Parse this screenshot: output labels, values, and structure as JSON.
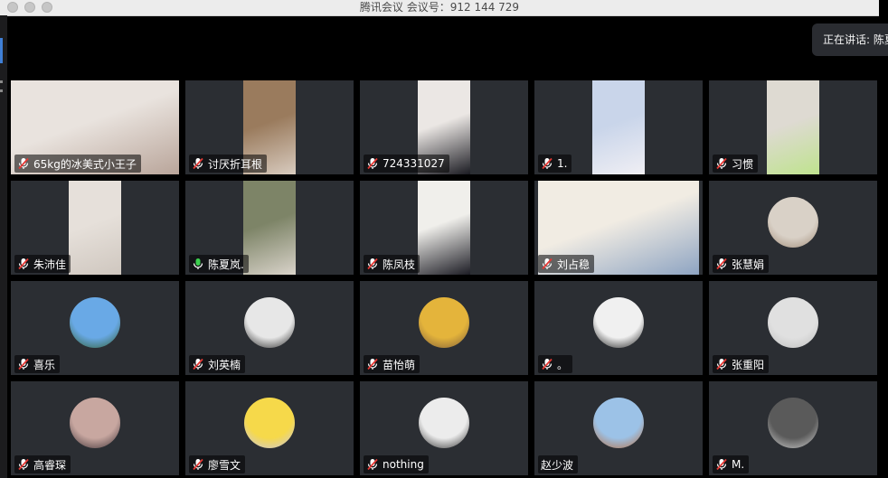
{
  "window": {
    "title": "腾讯会议 会议号：912 144 729"
  },
  "speaking_indicator": {
    "label": "正在讲话: 陈夏"
  },
  "participants": [
    {
      "name": "65kg的冰美式小王子",
      "mic": "muted",
      "media": "video",
      "palette": [
        "#e9e3de",
        "#b9a59a"
      ]
    },
    {
      "name": "讨厌折耳根",
      "mic": "muted",
      "media": "video",
      "palette": [
        "#9a7b5d",
        "#d8cbbf"
      ]
    },
    {
      "name": "724331027",
      "mic": "muted",
      "media": "video",
      "palette": [
        "#ebe7e4",
        "#1b1b22"
      ]
    },
    {
      "name": "1.",
      "mic": "muted",
      "media": "video",
      "palette": [
        "#c9d5ea",
        "#f0eff4"
      ]
    },
    {
      "name": "习惯",
      "mic": "muted",
      "media": "video",
      "palette": [
        "#dedad2",
        "#bfe38e"
      ]
    },
    {
      "name": "朱沛佳",
      "mic": "muted",
      "media": "video",
      "palette": [
        "#e6e0da",
        "#cfc7bf"
      ]
    },
    {
      "name": "陈夏岚.",
      "mic": "active",
      "media": "video",
      "palette": [
        "#7d8467",
        "#d9d3ca"
      ]
    },
    {
      "name": "陈凤枝",
      "mic": "muted",
      "media": "video",
      "palette": [
        "#f0efeb",
        "#1c1c24"
      ]
    },
    {
      "name": "刘占稳",
      "mic": "muted",
      "media": "video",
      "palette": [
        "#f1ece3",
        "#8ea4c2"
      ]
    },
    {
      "name": "张慧娟",
      "mic": "muted",
      "media": "avatar",
      "palette": [
        "#d9d1c7",
        "#9e8a76"
      ]
    },
    {
      "name": "喜乐",
      "mic": "muted",
      "media": "avatar",
      "palette": [
        "#69a9e6",
        "#2f5c2b"
      ]
    },
    {
      "name": "刘英楠",
      "mic": "muted",
      "media": "avatar",
      "palette": [
        "#e7e7e7",
        "#202020"
      ]
    },
    {
      "name": "苗怡萌",
      "mic": "muted",
      "media": "avatar",
      "palette": [
        "#e4b43b",
        "#7b5a3a"
      ]
    },
    {
      "name": "。",
      "mic": "muted",
      "media": "avatar",
      "palette": [
        "#f0f0f0",
        "#151515"
      ]
    },
    {
      "name": "张重阳",
      "mic": "muted",
      "media": "avatar",
      "palette": [
        "#e0e0e0",
        "#bdbdbd"
      ]
    },
    {
      "name": "高睿琛",
      "mic": "muted",
      "media": "avatar",
      "palette": [
        "#c8a7a0",
        "#3a2e33"
      ]
    },
    {
      "name": "廖雪文",
      "mic": "muted",
      "media": "avatar",
      "palette": [
        "#f6d94a",
        "#c8c6e8"
      ]
    },
    {
      "name": "nothing",
      "mic": "muted",
      "media": "avatar",
      "palette": [
        "#ececec",
        "#2a2a2a"
      ]
    },
    {
      "name": "赵少波",
      "mic": "none",
      "media": "avatar",
      "palette": [
        "#9cc2e7",
        "#b86c3c"
      ]
    },
    {
      "name": "M.",
      "mic": "muted",
      "media": "avatar",
      "palette": [
        "#5a5a5a",
        "#d4d4d4"
      ]
    }
  ],
  "icons": {
    "mic_muted": "mic-muted-icon",
    "mic_active": "mic-icon"
  },
  "colors": {
    "tile_bg": "#2b2e33",
    "muted_icon": "#ffffff",
    "muted_slash": "#e53935",
    "active_mic": "#3ccf4e"
  }
}
